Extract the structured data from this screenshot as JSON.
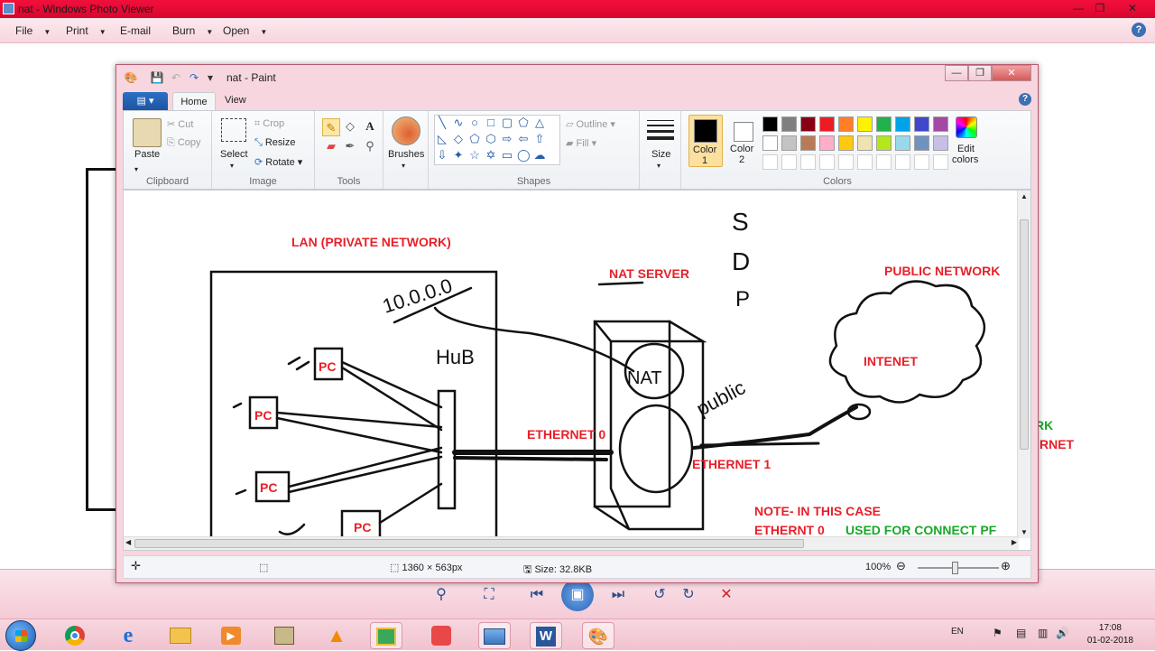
{
  "photo_viewer": {
    "title": "nat - Windows Photo Viewer",
    "menu": [
      {
        "label": "File"
      },
      {
        "label": "Print"
      },
      {
        "label": "E-mail"
      },
      {
        "label": "Burn"
      },
      {
        "label": "Open"
      }
    ]
  },
  "paint": {
    "title": "nat - Paint",
    "tabs": {
      "home": "Home",
      "view": "View"
    },
    "clipboard": {
      "paste": "Paste",
      "cut": "Cut",
      "copy": "Copy",
      "group": "Clipboard"
    },
    "image": {
      "select": "Select",
      "crop": "Crop",
      "resize": "Resize",
      "rotate": "Rotate",
      "group": "Image"
    },
    "tools": {
      "group": "Tools"
    },
    "brushes": {
      "label": "Brushes"
    },
    "shapes": {
      "outline": "Outline",
      "fill": "Fill",
      "group": "Shapes"
    },
    "size": {
      "label": "Size"
    },
    "color1": {
      "label": "Color",
      "num": "1"
    },
    "color2": {
      "label": "Color",
      "num": "2"
    },
    "edit_colors": {
      "label1": "Edit",
      "label2": "colors"
    },
    "colors_group": "Colors",
    "palette_row1": [
      "#000000",
      "#7f7f7f",
      "#880015",
      "#ed1c24",
      "#ff7f27",
      "#fff200",
      "#22b14c",
      "#00a2e8",
      "#3f48cc",
      "#a349a4"
    ],
    "palette_row2": [
      "#ffffff",
      "#c3c3c3",
      "#b97a57",
      "#ffaec9",
      "#ffc90e",
      "#efe4b0",
      "#b5e61d",
      "#99d9ea",
      "#7092be",
      "#c8bfe7"
    ],
    "status": {
      "dimensions": "1360 × 563px",
      "size": "Size: 32.8KB",
      "zoom": "100%"
    }
  },
  "drawing": {
    "lan_label": "LAN (PRIVATE NETWORK)",
    "nat_server": "NAT SERVER",
    "public_network": "PUBLIC NETWORK",
    "internet": "INTENET",
    "ethernet0": "ETHERNET 0",
    "ethernet1": "ETHERNET 1",
    "note_line1": "NOTE- IN THIS CASE",
    "note_line2a": "ETHERNT 0",
    "note_line2b": "USED FOR  CONNECT PF",
    "pc": "PC",
    "hub": "HuB",
    "ip": "10.0.0.0",
    "sdp": [
      "S",
      "D",
      "P"
    ],
    "nat": "NAT",
    "public": "public",
    "bg_text1": "RK",
    "bg_text2": "RNET"
  },
  "taskbar": {
    "lang": "EN",
    "time": "17:08",
    "date": "01-02-2018"
  }
}
